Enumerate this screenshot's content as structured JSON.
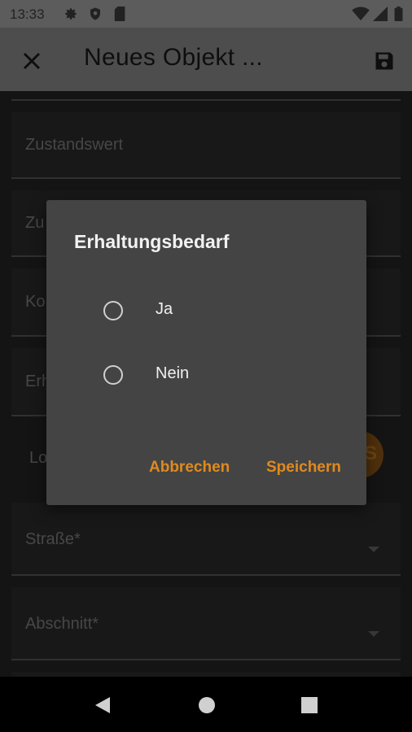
{
  "status_bar": {
    "time": "13:33"
  },
  "app_bar": {
    "title": "Neues Objekt ..."
  },
  "form": {
    "fields": [
      {
        "label": "Zustandswert"
      },
      {
        "label": "Zu"
      },
      {
        "label": "Ko"
      },
      {
        "label": "Erh"
      }
    ],
    "location_label": "Lo",
    "fab_label": "S",
    "dropdowns": [
      {
        "label": "Straße*"
      },
      {
        "label": "Abschnitt*"
      }
    ]
  },
  "dialog": {
    "title": "Erhaltungsbedarf",
    "options": [
      {
        "label": "Ja",
        "selected": false
      },
      {
        "label": "Nein",
        "selected": false
      }
    ],
    "cancel_label": "Abbrechen",
    "save_label": "Speichern"
  },
  "colors": {
    "accent": "#e08a1e",
    "dialog_bg": "#444444",
    "app_bar": "#777777"
  }
}
